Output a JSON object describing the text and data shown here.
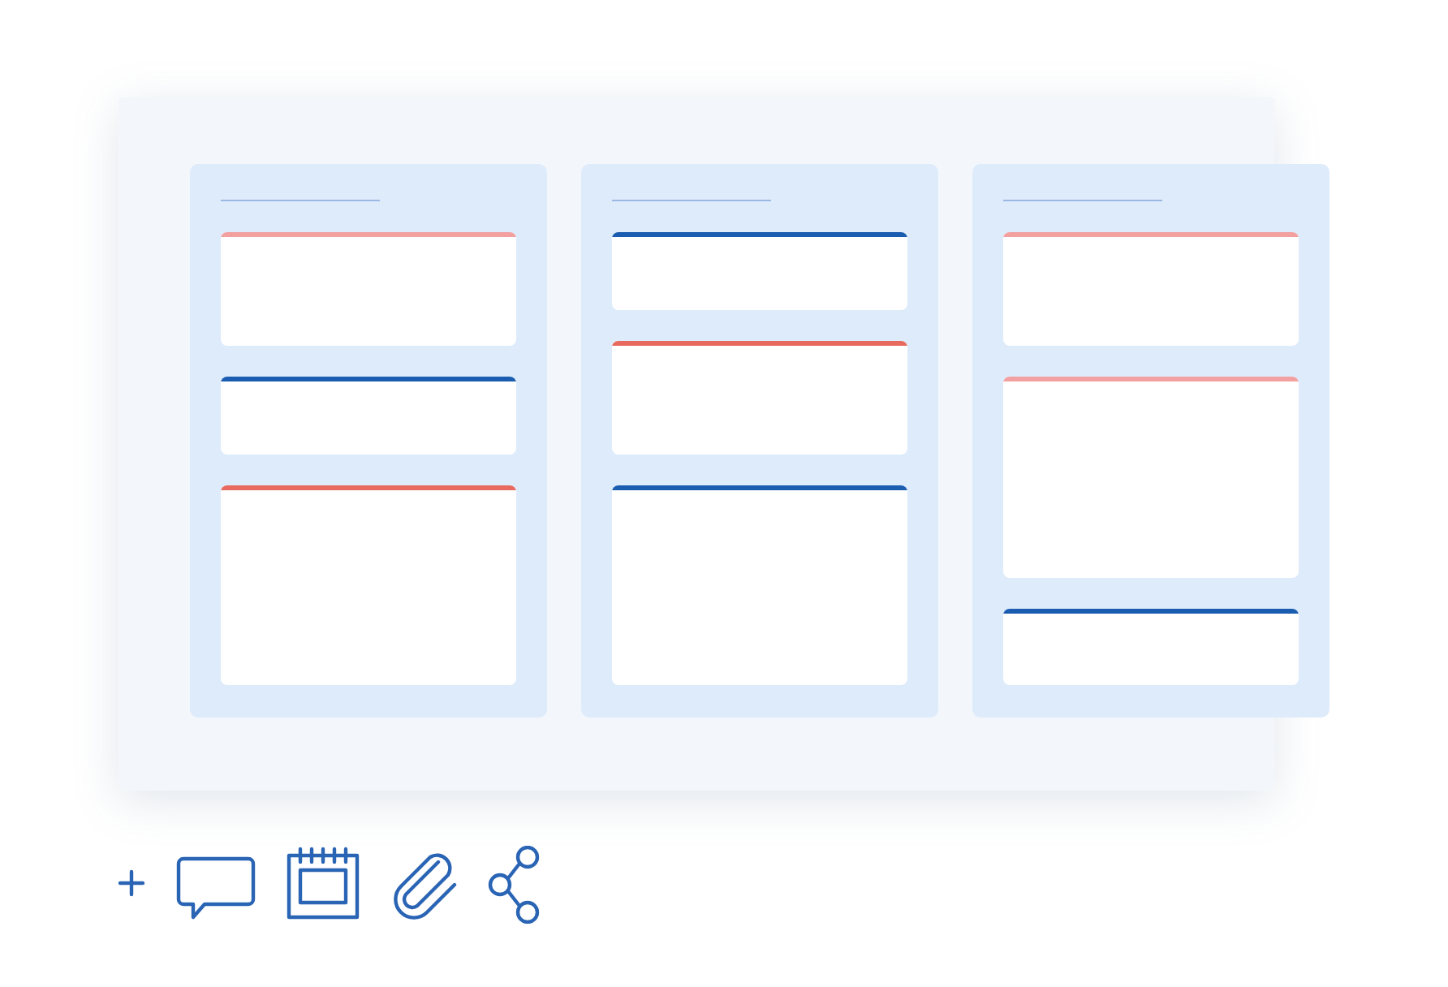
{
  "board": {
    "columns": [
      {
        "cards": [
          {
            "kind": "medium",
            "color": "#f2a0a0"
          },
          {
            "kind": "small",
            "color": "#1a5cb0"
          },
          {
            "kind": "large",
            "color": "#e8695e"
          }
        ]
      },
      {
        "cards": [
          {
            "kind": "small",
            "color": "#1a5cb0"
          },
          {
            "kind": "medium",
            "color": "#e8695e"
          },
          {
            "kind": "large",
            "color": "#1a5cb0"
          }
        ]
      },
      {
        "cards": [
          {
            "kind": "medium",
            "color": "#f2a0a0"
          },
          {
            "kind": "large",
            "color": "#f2a0a0"
          },
          {
            "kind": "small",
            "color": "#1a5cb0"
          }
        ]
      }
    ]
  },
  "toolbar": [
    {
      "kind": "add"
    },
    {
      "kind": "comment"
    },
    {
      "kind": "calendar"
    },
    {
      "kind": "attachment"
    },
    {
      "kind": "share"
    }
  ]
}
